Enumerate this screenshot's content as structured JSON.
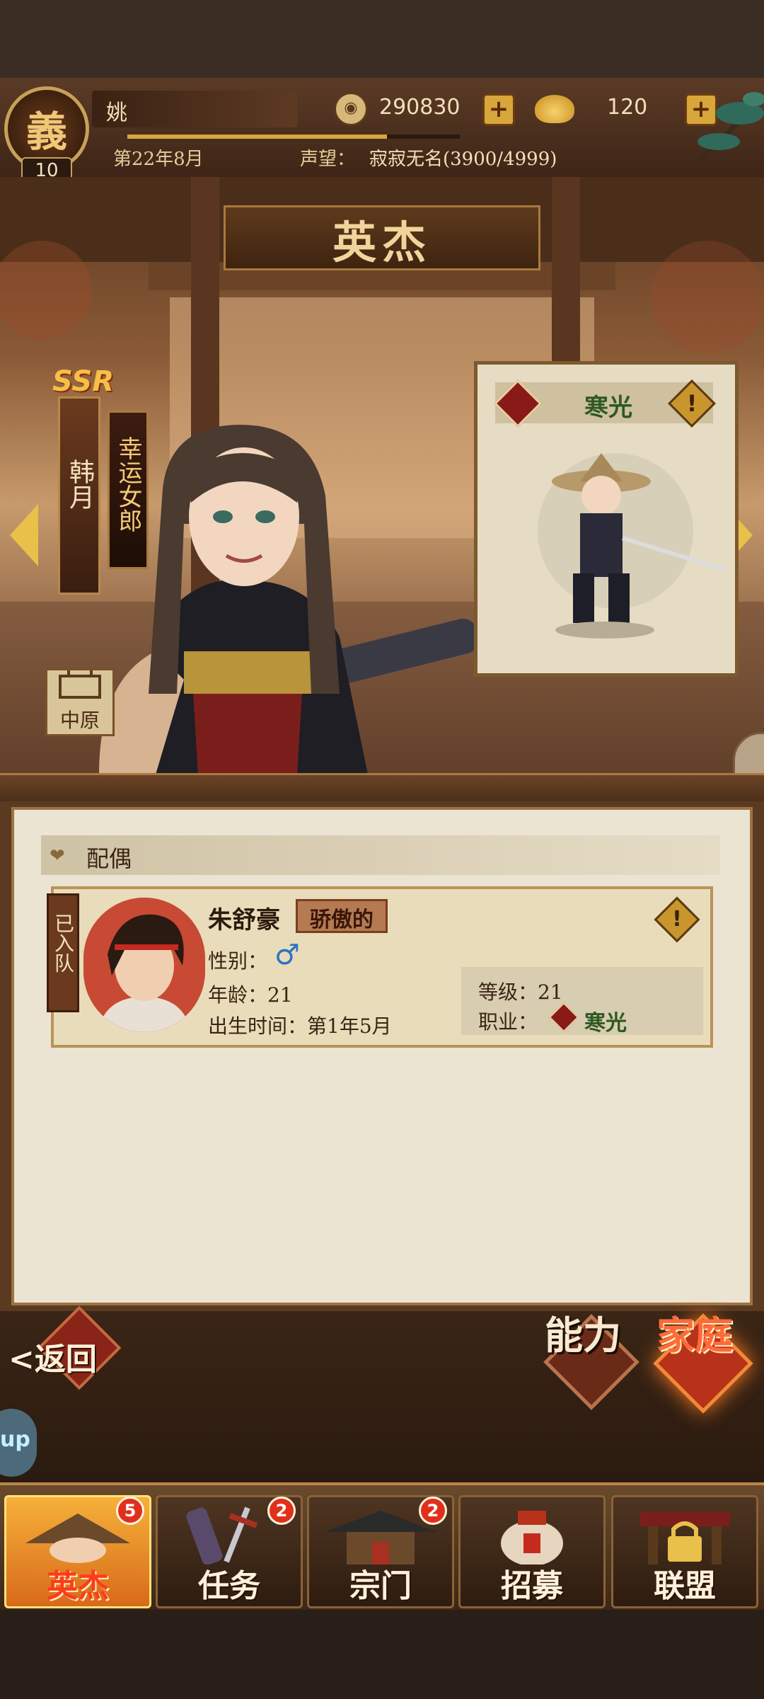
{
  "header": {
    "level_char": "義",
    "level": "10",
    "player_name": "姚",
    "coins": "290830",
    "ingots": "120",
    "date": "第22年8月",
    "reputation_label": "声望：",
    "reputation_value": "寂寂无名(3900/4999)",
    "reputation_progress": 0.78
  },
  "page_title": "英杰",
  "hero": {
    "rarity": "SSR",
    "name": "韩月",
    "title": "幸运女郎",
    "region": "中原"
  },
  "class_card": {
    "class_name": "寒光",
    "info_mark": "!"
  },
  "spouse_section": {
    "label": "配偶",
    "card": {
      "joined": "已入队",
      "name": "朱舒豪",
      "trait": "骄傲的",
      "info_mark": "!",
      "gender_label": "性别：",
      "gender_symbol": "♂",
      "age_label": "年龄：21",
      "birth_label": "出生时间：第1年5月",
      "level_label": "等级：",
      "level_value": "21",
      "job_label": "职业：",
      "job_name": "寒光"
    }
  },
  "actions": {
    "back": "返回",
    "ability": "能力",
    "family": "家庭"
  },
  "side_bubble": "up",
  "nav": [
    {
      "label": "英杰",
      "badge": "5",
      "active": true,
      "icon": "hat-hero-icon"
    },
    {
      "label": "任务",
      "badge": "2",
      "active": false,
      "icon": "scroll-sword-icon"
    },
    {
      "label": "宗门",
      "badge": "2",
      "active": false,
      "icon": "temple-icon"
    },
    {
      "label": "招募",
      "badge": "",
      "active": false,
      "icon": "wine-jar-icon"
    },
    {
      "label": "联盟",
      "badge": "",
      "active": false,
      "icon": "locked-gate-icon"
    }
  ],
  "colors": {
    "accent_gold": "#d8a63a",
    "active_tab": "#f6b03a",
    "badge_red": "#e0301c",
    "class_green": "#2e5a22"
  }
}
